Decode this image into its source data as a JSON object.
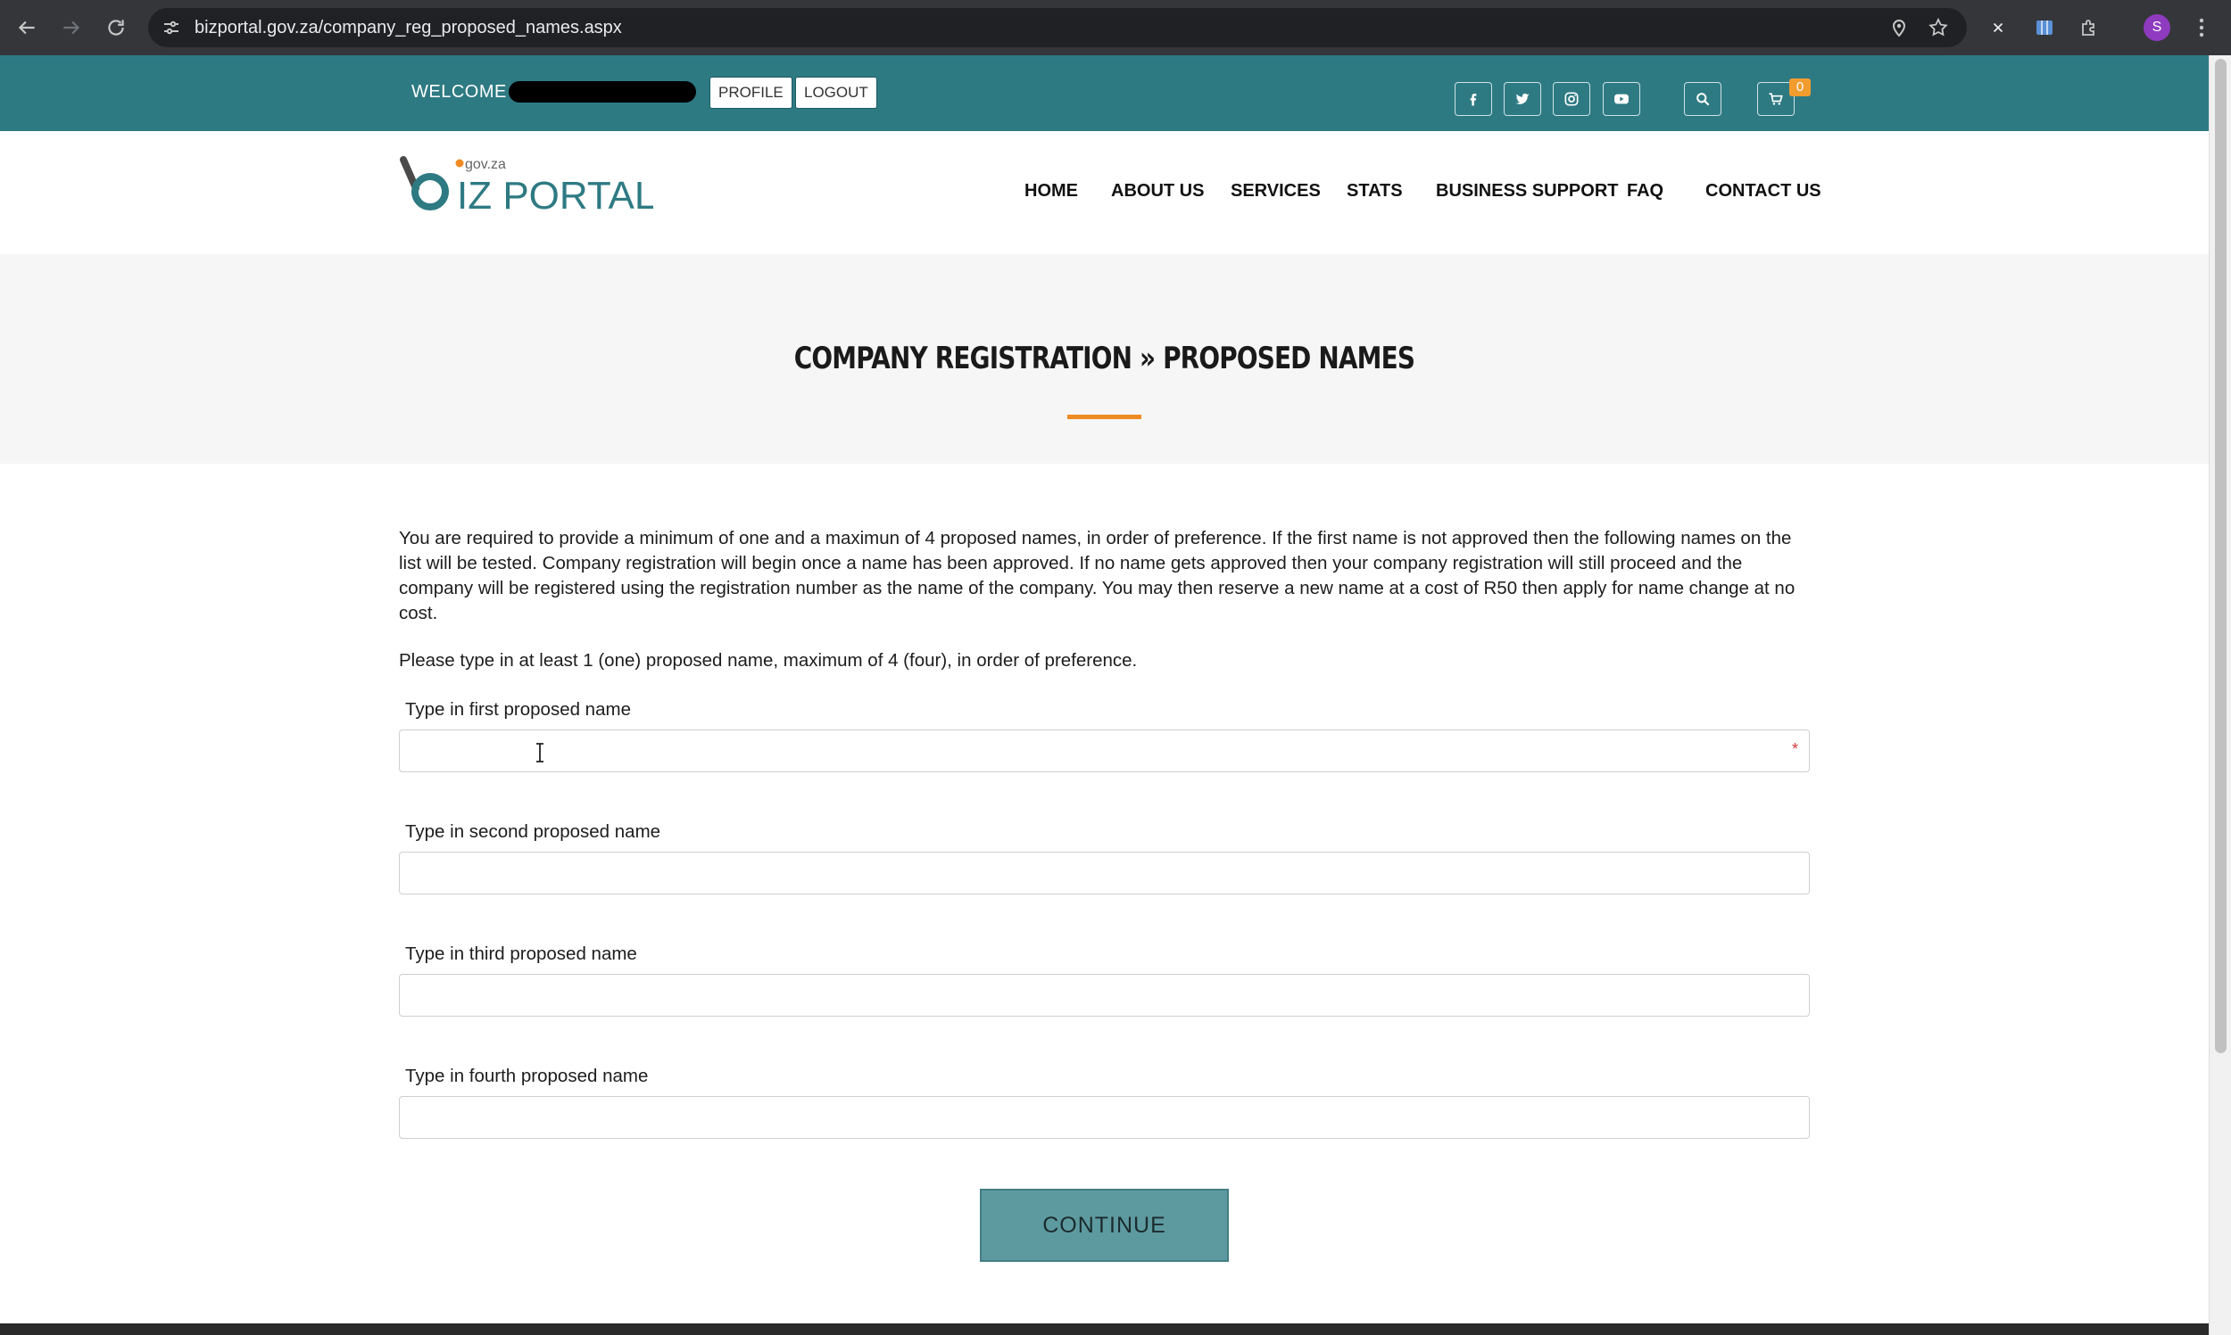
{
  "browser": {
    "url": "bizportal.gov.za/company_reg_proposed_names.aspx",
    "avatar_letter": "S"
  },
  "topbar": {
    "welcome": "WELCOME",
    "profile_label": "PROFILE",
    "logout_label": "LOGOUT",
    "cart_count": "0"
  },
  "logo": {
    "domain": "gov.za",
    "name": "IZ PORTAL"
  },
  "nav": {
    "items": [
      "HOME",
      "ABOUT US",
      "SERVICES",
      "STATS",
      "BUSINESS SUPPORT",
      "FAQ",
      "CONTACT US"
    ]
  },
  "page": {
    "title": "COMPANY REGISTRATION » PROPOSED NAMES",
    "intro": "You are required to provide a minimum of one and a maximun of 4 proposed names, in order of preference. If the first name is not approved then the following names on the list will be tested. Company registration will begin once a name has been approved. If no name gets approved then your company registration will still proceed and the company will be registered using the registration number as the name of the company. You may then reserve a new name at a cost of R50 then apply for name change at no cost.",
    "instruction": "Please type in at least 1 (one) proposed name, maximum of 4 (four), in order of preference."
  },
  "form": {
    "fields": [
      {
        "label": "Type in first proposed name",
        "value": "",
        "required_mark": "*"
      },
      {
        "label": "Type in second proposed name",
        "value": ""
      },
      {
        "label": "Type in third proposed name",
        "value": ""
      },
      {
        "label": "Type in fourth proposed name",
        "value": ""
      }
    ],
    "continue_label": "CONTINUE"
  },
  "colors": {
    "topbar": "#2e7a83",
    "accent_underline": "#f08a24",
    "button": "#5d9aa0",
    "required": "#d33a3a"
  }
}
